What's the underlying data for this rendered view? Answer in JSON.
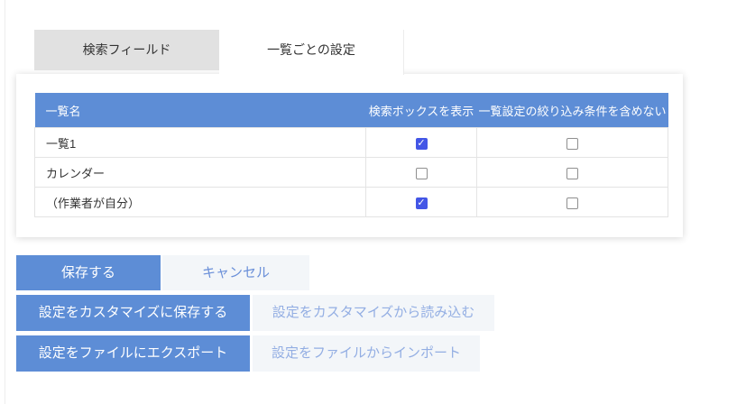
{
  "tabs": [
    {
      "label": "検索フィールド",
      "active": false
    },
    {
      "label": "一覧ごとの設定",
      "active": true
    }
  ],
  "table": {
    "columns": [
      "一覧名",
      "検索ボックスを表示",
      "一覧設定の絞り込み条件を含めない"
    ],
    "rows": [
      {
        "name": "一覧1",
        "show_search_box": true,
        "exclude_filter": false
      },
      {
        "name": "カレンダー",
        "show_search_box": false,
        "exclude_filter": false
      },
      {
        "name": "（作業者が自分）",
        "show_search_box": true,
        "exclude_filter": false
      }
    ]
  },
  "buttons": {
    "save": "保存する",
    "cancel": "キャンセル",
    "save_customize": "設定をカスタマイズに保存する",
    "load_customize": "設定をカスタマイズから読み込む",
    "export_file": "設定をファイルにエクスポート",
    "import_file": "設定をファイルからインポート"
  },
  "colors": {
    "accent_blue": "#5d8dd6",
    "checkbox_blue": "#4356e6",
    "tab_gray": "#e1e1e1",
    "light_btn_bg": "#f3f6f9",
    "secondary_text": "#6b90d9",
    "faded_text": "#93aee3"
  }
}
